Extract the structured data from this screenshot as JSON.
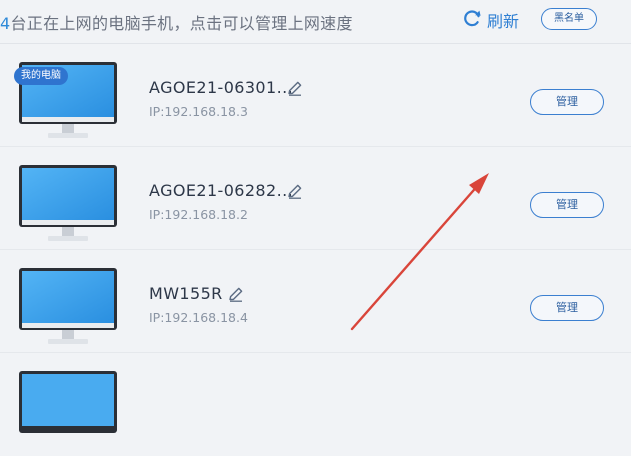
{
  "header": {
    "count": "4",
    "summary_rest": "台正在上网的电脑手机，点击可以管理上网速度",
    "refresh_label": "刷新",
    "blacklist_label": "黑名单"
  },
  "devices": [
    {
      "name": "AGOE21-06301...",
      "ip": "IP:192.168.18.3",
      "badge": "我的电脑",
      "manage_label": "管理"
    },
    {
      "name": "AGOE21-06282...",
      "ip": "IP:192.168.18.2",
      "manage_label": "管理"
    },
    {
      "name": "MW155R",
      "ip": "IP:192.168.18.4",
      "manage_label": "管理"
    }
  ],
  "colors": {
    "accent": "#2f7fd3",
    "arrow": "#d9453a",
    "screen": "#3ca0ec"
  },
  "icons": {
    "refresh": "refresh-icon",
    "edit": "pencil-edit-icon",
    "device": "monitor-icon"
  }
}
